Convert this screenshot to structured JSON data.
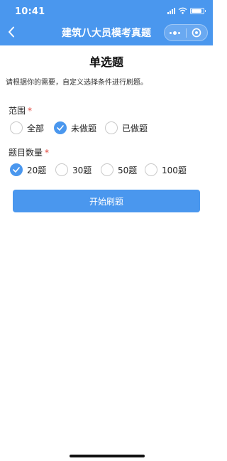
{
  "status_bar": {
    "time": "10:41",
    "battery_level": 0.85
  },
  "nav": {
    "title": "建筑八大员模考真题",
    "icons": {
      "back": "chevron-left-icon",
      "more": "more-dots-icon",
      "close": "capsule-close-icon"
    }
  },
  "page": {
    "title": "单选题",
    "description": "请根据你的需要，自定义选择条件进行刷题。"
  },
  "scope": {
    "label": "范围",
    "required_mark": "*",
    "options": [
      {
        "label": "全部",
        "checked": false
      },
      {
        "label": "未做题",
        "checked": true
      },
      {
        "label": "已做题",
        "checked": false
      }
    ]
  },
  "count": {
    "label": "题目数量",
    "required_mark": "*",
    "options": [
      {
        "label": "20题",
        "checked": true
      },
      {
        "label": "30题",
        "checked": false
      },
      {
        "label": "50题",
        "checked": false
      },
      {
        "label": "100题",
        "checked": false
      }
    ]
  },
  "start_button": {
    "label": "开始刷题"
  },
  "colors": {
    "accent": "#4a97ee",
    "required": "#e0443a",
    "unchecked_border": "#c9c9c9"
  }
}
